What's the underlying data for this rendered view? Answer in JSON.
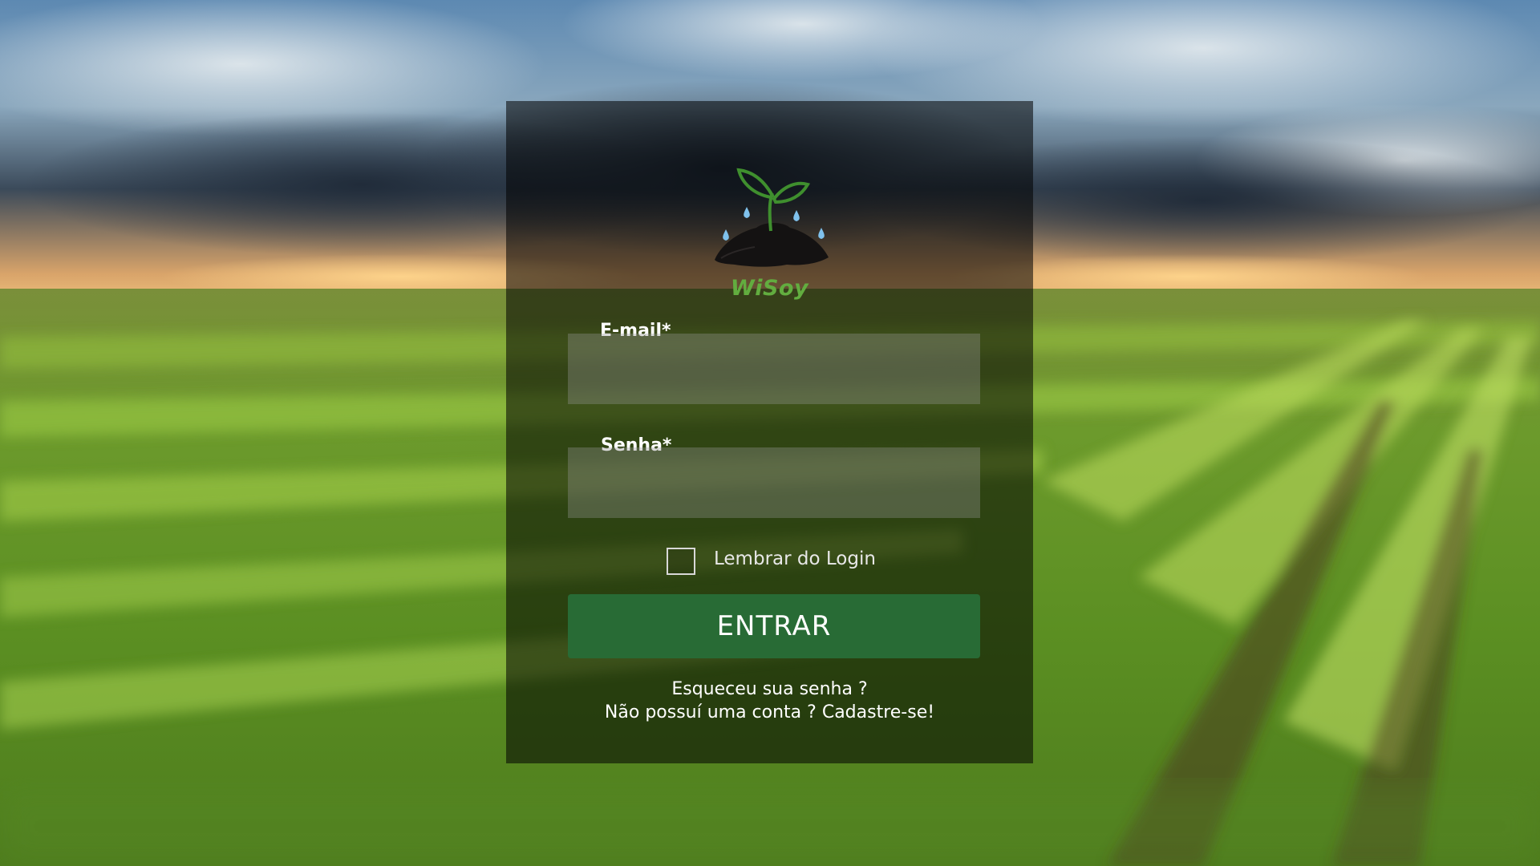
{
  "brand": {
    "name": "WiSoy",
    "color": "#62ad3f"
  },
  "form": {
    "email_label": "E-mail*",
    "email_value": "",
    "password_label": "Senha*",
    "password_value": "",
    "remember_label": "Lembrar do Login",
    "remember_checked": false,
    "submit_label": "ENTRAR"
  },
  "links": {
    "forgot": "Esqueceu sua senha ?",
    "signup": "Não possuí uma conta ? Cadastre-se!"
  },
  "colors": {
    "button": "#286b35",
    "panel_overlay": "rgba(0,0,0,0.55)"
  },
  "icons": {
    "logo": "seedling-soil-waterdrops-icon"
  }
}
